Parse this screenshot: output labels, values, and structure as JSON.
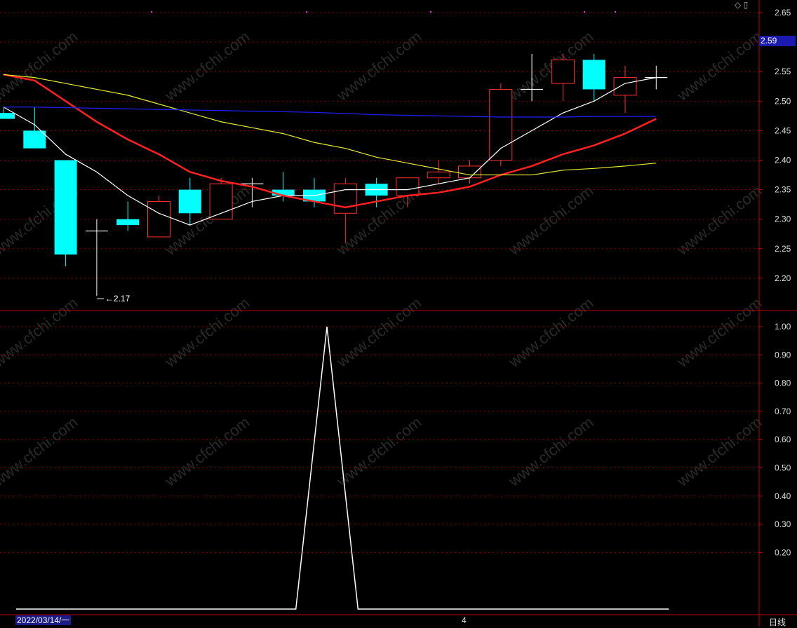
{
  "chart_data": [
    {
      "type": "candlestick",
      "panel": "price",
      "ylim": [
        2.15,
        2.67
      ],
      "yticks": [
        "2.65",
        "2.60",
        "2.55",
        "2.50",
        "2.45",
        "2.40",
        "2.35",
        "2.30",
        "2.25",
        "2.20"
      ],
      "current_price": "2.59",
      "low_marker": "2.17",
      "candles": [
        {
          "o": 2.48,
          "h": 2.49,
          "l": 2.47,
          "c": 2.47
        },
        {
          "o": 2.45,
          "h": 2.49,
          "l": 2.42,
          "c": 2.42
        },
        {
          "o": 2.4,
          "h": 2.4,
          "l": 2.22,
          "c": 2.24
        },
        {
          "o": 2.28,
          "h": 2.3,
          "l": 2.17,
          "c": 2.28
        },
        {
          "o": 2.3,
          "h": 2.33,
          "l": 2.28,
          "c": 2.29
        },
        {
          "o": 2.27,
          "h": 2.34,
          "l": 2.27,
          "c": 2.33
        },
        {
          "o": 2.35,
          "h": 2.37,
          "l": 2.29,
          "c": 2.31
        },
        {
          "o": 2.3,
          "h": 2.37,
          "l": 2.3,
          "c": 2.36
        },
        {
          "o": 2.36,
          "h": 2.37,
          "l": 2.32,
          "c": 2.36
        },
        {
          "o": 2.35,
          "h": 2.38,
          "l": 2.33,
          "c": 2.34
        },
        {
          "o": 2.35,
          "h": 2.37,
          "l": 2.32,
          "c": 2.33
        },
        {
          "o": 2.31,
          "h": 2.37,
          "l": 2.26,
          "c": 2.36
        },
        {
          "o": 2.36,
          "h": 2.37,
          "l": 2.32,
          "c": 2.34
        },
        {
          "o": 2.34,
          "h": 2.37,
          "l": 2.32,
          "c": 2.37
        },
        {
          "o": 2.37,
          "h": 2.4,
          "l": 2.36,
          "c": 2.38
        },
        {
          "o": 2.37,
          "h": 2.4,
          "l": 2.36,
          "c": 2.39
        },
        {
          "o": 2.4,
          "h": 2.53,
          "l": 2.39,
          "c": 2.52
        },
        {
          "o": 2.52,
          "h": 2.58,
          "l": 2.5,
          "c": 2.52
        },
        {
          "o": 2.53,
          "h": 2.58,
          "l": 2.5,
          "c": 2.57
        },
        {
          "o": 2.57,
          "h": 2.58,
          "l": 2.5,
          "c": 2.52
        },
        {
          "o": 2.51,
          "h": 2.56,
          "l": 2.48,
          "c": 2.54
        },
        {
          "o": 2.54,
          "h": 2.56,
          "l": 2.52,
          "c": 2.54
        }
      ],
      "series": [
        {
          "color": "#ffffff",
          "values": [
            2.49,
            2.46,
            2.41,
            2.38,
            2.34,
            2.31,
            2.29,
            2.31,
            2.33,
            2.34,
            2.34,
            2.35,
            2.35,
            2.35,
            2.36,
            2.37,
            2.42,
            2.45,
            2.48,
            2.5,
            2.53,
            2.54
          ]
        },
        {
          "color": "#ff2020",
          "values": [
            2.545,
            2.535,
            2.5,
            2.465,
            2.435,
            2.41,
            2.38,
            2.365,
            2.355,
            2.34,
            2.33,
            2.32,
            2.33,
            2.34,
            2.345,
            2.355,
            2.375,
            2.39,
            2.41,
            2.425,
            2.445,
            2.47
          ]
        },
        {
          "color": "#e8e830",
          "values": [
            2.545,
            2.54,
            2.53,
            2.52,
            2.51,
            2.495,
            2.48,
            2.465,
            2.455,
            2.445,
            2.43,
            2.42,
            2.405,
            2.395,
            2.385,
            2.375,
            2.375,
            2.375,
            2.383,
            2.386,
            2.39,
            2.395
          ]
        },
        {
          "color": "#2020ff",
          "values": [
            2.49,
            2.49,
            2.489,
            2.488,
            2.487,
            2.486,
            2.485,
            2.484,
            2.483,
            2.482,
            2.481,
            2.479,
            2.477,
            2.476,
            2.475,
            2.474,
            2.473,
            2.473,
            2.473,
            2.474,
            2.474,
            2.474
          ]
        }
      ]
    },
    {
      "type": "line",
      "panel": "indicator",
      "ylim": [
        0,
        1.05
      ],
      "yticks": [
        "1.00",
        "0.90",
        "0.80",
        "0.70",
        "0.60",
        "0.50",
        "0.40",
        "0.30",
        "0.20"
      ],
      "series": [
        {
          "color": "#ffffff",
          "values": [
            0,
            0,
            0,
            0,
            0,
            0,
            0,
            0,
            0,
            0,
            1,
            0,
            0,
            0,
            0,
            0,
            0,
            0,
            0,
            0,
            0,
            0
          ]
        }
      ]
    }
  ],
  "footer": {
    "date": "2022/03/14/一",
    "cursor_mark": "4",
    "period": "日线"
  },
  "watermark": "www.cfchi.com",
  "colors": {
    "up": "#ff3030",
    "down": "#00ffff",
    "grid": "#8b0000",
    "axis": "#c00000"
  }
}
